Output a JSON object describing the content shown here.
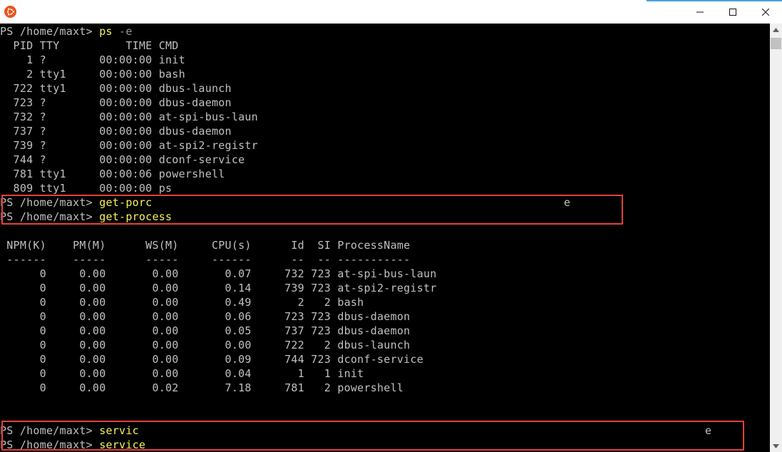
{
  "window": {
    "title": "",
    "icon": "ubuntu-icon",
    "controls": {
      "minimize": "minimize-icon",
      "maximize": "maximize-icon",
      "close": "close-icon"
    }
  },
  "console": {
    "lines": [
      {
        "prompt": "PS /home/maxt> ",
        "cmd": "ps",
        "args": " -e"
      },
      {
        "text": "  PID TTY          TIME CMD"
      },
      {
        "text": "    1 ?        00:00:00 init"
      },
      {
        "text": "    2 tty1     00:00:00 bash"
      },
      {
        "text": "  722 tty1     00:00:00 dbus-launch"
      },
      {
        "text": "  723 ?        00:00:00 dbus-daemon"
      },
      {
        "text": "  732 ?        00:00:00 at-spi-bus-laun"
      },
      {
        "text": "  737 ?        00:00:00 dbus-daemon"
      },
      {
        "text": "  739 ?        00:00:00 at-spi2-registr"
      },
      {
        "text": "  744 ?        00:00:00 dconf-service"
      },
      {
        "text": "  781 tty1     00:00:06 powershell"
      },
      {
        "text": "  809 tty1     00:00:00 ps"
      },
      {
        "prompt": "PS /home/maxt> ",
        "cmd": "get-porc",
        "stray": "e"
      },
      {
        "prompt": "PS /home/maxt> ",
        "cmd": "get-process"
      },
      {
        "text": ""
      },
      {
        "text": " NPM(K)    PM(M)      WS(M)     CPU(s)      Id  SI ProcessName"
      },
      {
        "text": " ------    -----      -----     ------      --  -- -----------"
      },
      {
        "text": "      0     0.00       0.00       0.07     732 723 at-spi-bus-laun"
      },
      {
        "text": "      0     0.00       0.00       0.14     739 723 at-spi2-registr"
      },
      {
        "text": "      0     0.00       0.00       0.49       2   2 bash"
      },
      {
        "text": "      0     0.00       0.00       0.06     723 723 dbus-daemon"
      },
      {
        "text": "      0     0.00       0.00       0.05     737 723 dbus-daemon"
      },
      {
        "text": "      0     0.00       0.00       0.00     722   2 dbus-launch"
      },
      {
        "text": "      0     0.00       0.00       0.09     744 723 dconf-service"
      },
      {
        "text": "      0     0.00       0.00       0.04       1   1 init"
      },
      {
        "text": "      0     0.00       0.02       7.18     781   2 powershell"
      },
      {
        "text": ""
      },
      {
        "text": ""
      },
      {
        "prompt": "PS /home/maxt> ",
        "cmd": "servic",
        "stray": "e"
      },
      {
        "prompt": "PS /home/maxt> ",
        "cmd": "service"
      }
    ]
  },
  "colors": {
    "background": "#000000",
    "text": "#c0c0c0",
    "command": "#f7f15a",
    "highlight_border": "#e5403a"
  }
}
